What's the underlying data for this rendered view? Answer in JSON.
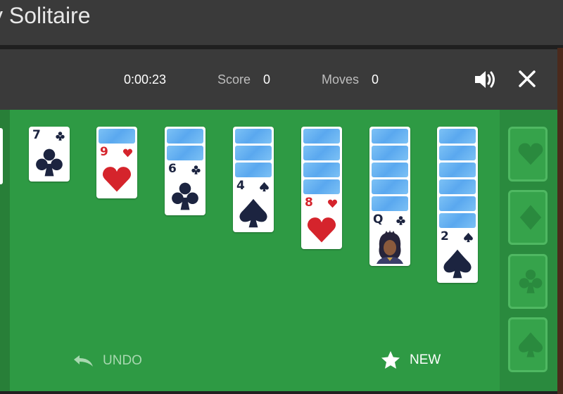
{
  "page": {
    "title": "y Solitaire"
  },
  "stats": {
    "time": "0:00:23",
    "score_label": "Score",
    "score": "0",
    "moves_label": "Moves",
    "moves": "0"
  },
  "controls": {
    "sound_icon": "speaker-icon",
    "close_icon": "close-icon"
  },
  "actions": {
    "undo_label": "UNDO",
    "new_label": "NEW"
  },
  "tableau": [
    {
      "rank": "7",
      "suit": "clubs",
      "color": "black",
      "face_down": 0
    },
    {
      "rank": "9",
      "suit": "hearts",
      "color": "red",
      "face_down": 1
    },
    {
      "rank": "6",
      "suit": "clubs",
      "color": "black",
      "face_down": 2
    },
    {
      "rank": "4",
      "suit": "spades",
      "color": "black",
      "face_down": 3
    },
    {
      "rank": "8",
      "suit": "hearts",
      "color": "red",
      "face_down": 4
    },
    {
      "rank": "Q",
      "suit": "clubs",
      "color": "black",
      "face_down": 5
    },
    {
      "rank": "2",
      "suit": "spades",
      "color": "black",
      "face_down": 6
    }
  ],
  "foundations": [
    "hearts",
    "diamonds",
    "clubs",
    "spades"
  ],
  "colors": {
    "felt": "#2e9a44",
    "card_back": "#6cb6f2",
    "red_suit": "#d5242c",
    "black_suit": "#1c2440"
  }
}
